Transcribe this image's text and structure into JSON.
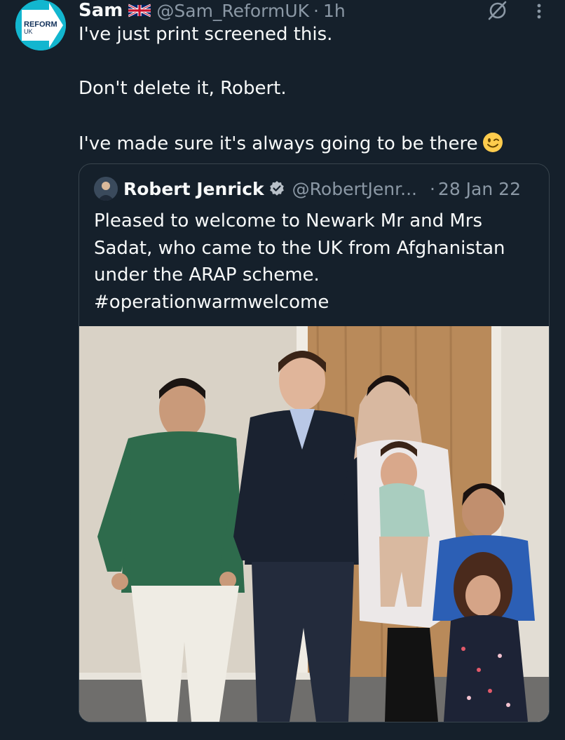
{
  "author": {
    "display_name": "Sam",
    "handle": "@Sam_ReformUK",
    "separator": "·",
    "time": "1h",
    "avatar_text": [
      "REFORM",
      "UK"
    ],
    "avatar_color": "#12b6cf"
  },
  "tweet": {
    "lines": [
      "I've just print screened this.",
      "Don't delete it, Robert.",
      "I've made sure it's always going to be there"
    ]
  },
  "quoted": {
    "display_name": "Robert Jenrick",
    "handle": "@RobertJenr...",
    "separator": "·",
    "date": "28 Jan 22",
    "lines": [
      "Pleased to welcome to Newark Mr and Mrs",
      "Sadat, who came to the UK from Afghanistan",
      "under the ARAP scheme.",
      "#operationwarmwelcome"
    ]
  },
  "icons": {
    "grok": "grok-icon",
    "more": "more-vertical-icon",
    "flag": "uk-flag-icon",
    "verified": "verified-badge-icon",
    "emoji": "winking-face-emoji"
  },
  "colors": {
    "background": "#15202b",
    "text": "#f7f9f9",
    "secondary_text": "#8b98a5",
    "border": "#38444d"
  }
}
